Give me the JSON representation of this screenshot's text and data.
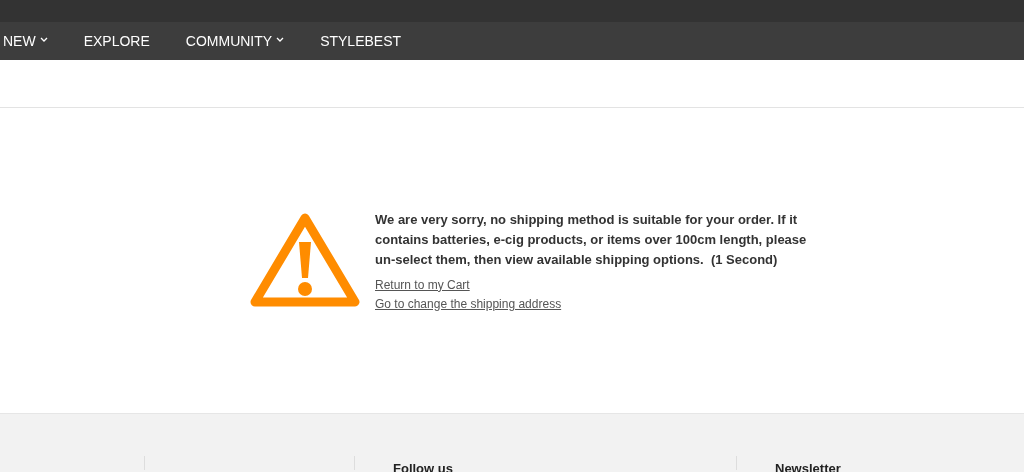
{
  "nav": {
    "items": [
      {
        "label": "NEW",
        "dropdown": true
      },
      {
        "label": "EXPLORE",
        "dropdown": false
      },
      {
        "label": "COMMUNITY",
        "dropdown": true
      },
      {
        "label": "STYLEBEST",
        "dropdown": false
      }
    ]
  },
  "notice": {
    "message": "We are very sorry, no shipping method is suitable for your order. If it contains batteries, e-cig products, or items over 100cm length, please un-select them, then view available shipping options.  (1 Second)",
    "links": [
      "Return to my Cart",
      "Go to change the shipping address"
    ]
  },
  "footer": {
    "headings": [
      "Follow us",
      "Newsletter"
    ]
  }
}
